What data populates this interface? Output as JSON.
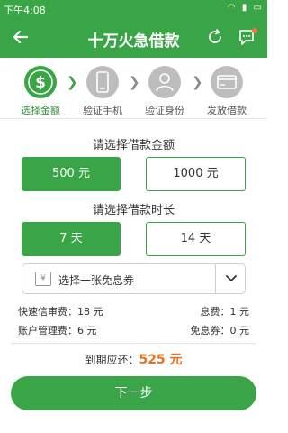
{
  "status_bar": {
    "time": "下午4:08"
  },
  "nav": {
    "title": "十万火急借款",
    "back_icon": "back-arrow-icon",
    "refresh_icon": "refresh-icon",
    "message_icon": "message-icon"
  },
  "steps": [
    {
      "label": "选择金额",
      "icon": "dollar-icon",
      "active": true
    },
    {
      "label": "验证手机",
      "icon": "phone-icon",
      "active": false
    },
    {
      "label": "验证身份",
      "icon": "person-icon",
      "active": false
    },
    {
      "label": "发放借款",
      "icon": "card-icon",
      "active": false
    }
  ],
  "amount": {
    "title": "请选择借款金额",
    "options": [
      "500 元",
      "1000 元"
    ],
    "selected": "500 元"
  },
  "duration": {
    "title": "请选择借款时长",
    "options": [
      "7 天",
      "14 天"
    ],
    "selected": "7 天"
  },
  "coupon": {
    "icon_text": "¥",
    "label": "选择一张免息券"
  },
  "fees": [
    {
      "left": "快速信审费：18 元",
      "right": "息费：1 元"
    },
    {
      "left": "账户管理费：6 元",
      "right": "免息券：0 元"
    }
  ],
  "total": {
    "label": "到期应还：",
    "amount": "525 元"
  },
  "next_button": "下一步",
  "colors": {
    "primary": "#3aa546",
    "accent": "#e8731a",
    "inactive": "#bdbdbd"
  }
}
